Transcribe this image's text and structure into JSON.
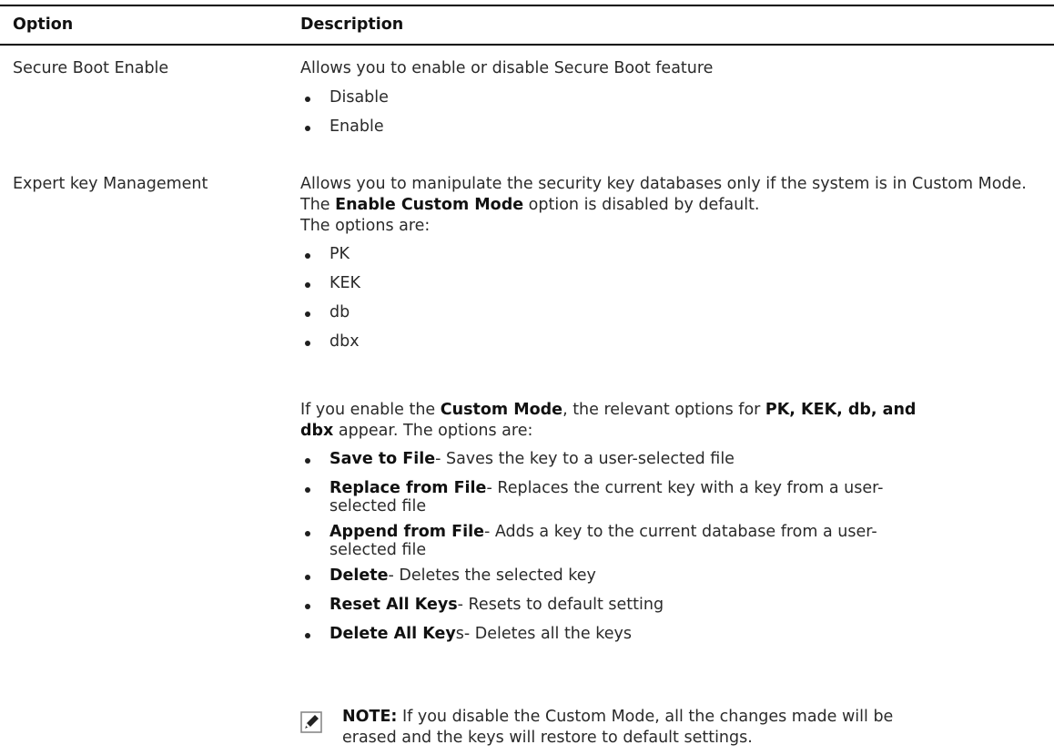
{
  "header": {
    "option_label": "Option",
    "description_label": "Description"
  },
  "rows": [
    {
      "option": "Secure Boot Enable",
      "intro": "Allows you to enable or disable Secure Boot feature",
      "items": [
        "Disable",
        "Enable"
      ]
    },
    {
      "option": "Expert key Management",
      "intro_before": "Allows you to manipulate the security key databases only if the system is in Custom Mode. The ",
      "intro_bold": "Enable Custom Mode",
      "intro_after": " option is disabled by default.",
      "intro_line3": "The options are:",
      "items": [
        "PK",
        "KEK",
        "db",
        "dbx"
      ],
      "para2_a": "If you enable the ",
      "para2_b": "Custom Mode",
      "para2_c": ", the relevant options for ",
      "para2_d": "PK, KEK, db, and",
      "para2_e": "dbx",
      "para2_f": " appear. The options are:",
      "custom_items": [
        {
          "bold": "Save to File",
          "text": "- Saves the key to a user-selected file",
          "sub": ""
        },
        {
          "bold": "Replace from File",
          "text": "- Replaces the current key with a key from a user-",
          "sub": "selected file"
        },
        {
          "bold": "Append from File",
          "text": "- Adds a key to the current database from a user-",
          "sub": "selected file"
        },
        {
          "bold": "Delete",
          "text": "- Deletes the selected key",
          "sub": ""
        },
        {
          "bold": "Reset All Keys",
          "text": "- Resets to default setting",
          "sub": ""
        },
        {
          "bold": "Delete All Key",
          "text": "s- Deletes all the keys",
          "sub": ""
        }
      ]
    }
  ],
  "note": {
    "label": "NOTE:",
    "line1": " If you disable the Custom Mode, all the changes made will be",
    "line2": "erased and the keys will restore to default settings.",
    "icon": "pencil-note-icon"
  }
}
